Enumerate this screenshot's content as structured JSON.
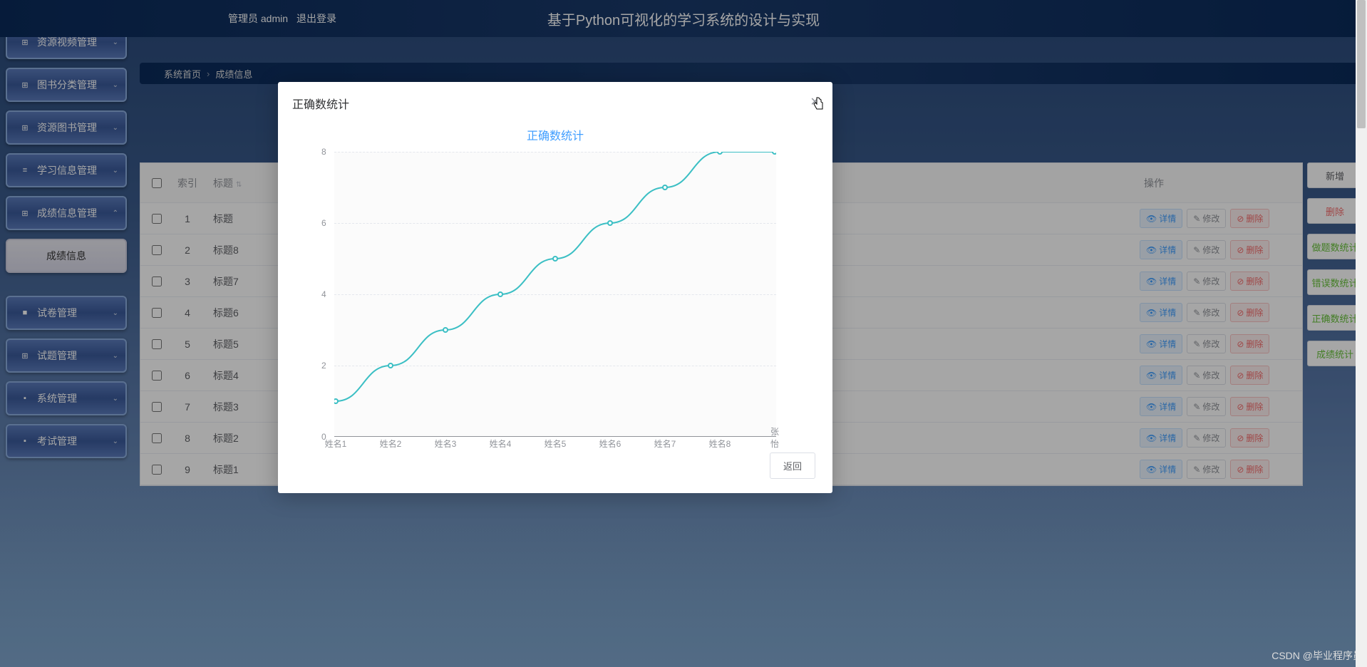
{
  "header": {
    "admin_label": "管理员 admin",
    "logout_label": "退出登录",
    "title": "基于Python可视化的学习系统的设计与实现"
  },
  "sidebar": {
    "items": [
      {
        "label": "资源视频管理",
        "icon": "⊞"
      },
      {
        "label": "图书分类管理",
        "icon": "⊞"
      },
      {
        "label": "资源图书管理",
        "icon": "⊞"
      },
      {
        "label": "学习信息管理",
        "icon": "≡"
      },
      {
        "label": "成绩信息管理",
        "icon": "⊞"
      },
      {
        "label": "成绩信息",
        "icon": ""
      },
      {
        "label": "试卷管理",
        "icon": "■"
      },
      {
        "label": "试题管理",
        "icon": "⊞"
      },
      {
        "label": "系统管理",
        "icon": "▪"
      },
      {
        "label": "考试管理",
        "icon": "▪"
      }
    ]
  },
  "breadcrumb": {
    "home": "系统首页",
    "current": "成绩信息"
  },
  "table": {
    "header": {
      "index": "索引",
      "title": "标题",
      "ops": "操作"
    },
    "rows": [
      {
        "idx": "1",
        "title": "标题"
      },
      {
        "idx": "2",
        "title": "标题8"
      },
      {
        "idx": "3",
        "title": "标题7"
      },
      {
        "idx": "4",
        "title": "标题6"
      },
      {
        "idx": "5",
        "title": "标题5"
      },
      {
        "idx": "6",
        "title": "标题4"
      },
      {
        "idx": "7",
        "title": "标题3"
      },
      {
        "idx": "8",
        "title": "标题2"
      },
      {
        "idx": "9",
        "title": "标题1"
      }
    ],
    "ops": {
      "detail": "详情",
      "edit": "修改",
      "del": "删除"
    }
  },
  "right_actions": {
    "new": "新增",
    "del": "删除",
    "stat1": "做题数统计",
    "stat2": "错误数统计",
    "stat3": "正确数统计",
    "stat4": "成绩统计"
  },
  "modal": {
    "title": "正确数统计",
    "chart_title": "正确数统计",
    "return": "返回"
  },
  "chart_data": {
    "type": "line",
    "title": "正确数统计",
    "xlabel": "",
    "ylabel": "",
    "ylim": [
      0,
      8
    ],
    "yticks": [
      0,
      2,
      4,
      6,
      8
    ],
    "categories": [
      "姓名1",
      "姓名2",
      "姓名3",
      "姓名4",
      "姓名5",
      "姓名6",
      "姓名7",
      "姓名8",
      "张怡"
    ],
    "values": [
      1,
      2,
      3,
      4,
      5,
      6,
      7,
      8,
      8
    ]
  },
  "watermark": "CSDN @毕业程序员"
}
